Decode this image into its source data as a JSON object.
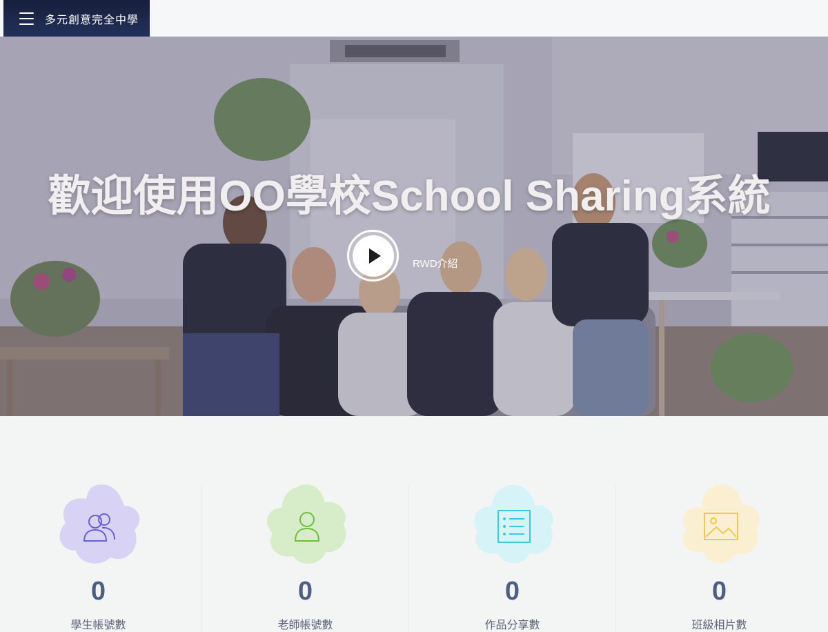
{
  "header": {
    "site_title": "多元創意完全中學",
    "menu_icon": "hamburger-menu-icon"
  },
  "hero": {
    "title": "歡迎使用OO學校School Sharing系統",
    "play_icon": "play-icon",
    "video_label": "RWD介紹"
  },
  "stats": [
    {
      "count": "0",
      "label": "學生帳號數",
      "icon": "students-icon",
      "blob_color": "#d8d3f5",
      "icon_color": "#6a5fd0"
    },
    {
      "count": "0",
      "label": "老師帳號數",
      "icon": "teacher-icon",
      "blob_color": "#d7ecc8",
      "icon_color": "#6cbf3c"
    },
    {
      "count": "0",
      "label": "作品分享數",
      "icon": "list-document-icon",
      "blob_color": "#d6f3f8",
      "icon_color": "#3ec6dc"
    },
    {
      "count": "0",
      "label": "班級相片數",
      "icon": "image-icon",
      "blob_color": "#fbefd2",
      "icon_color": "#f0c84e"
    }
  ]
}
